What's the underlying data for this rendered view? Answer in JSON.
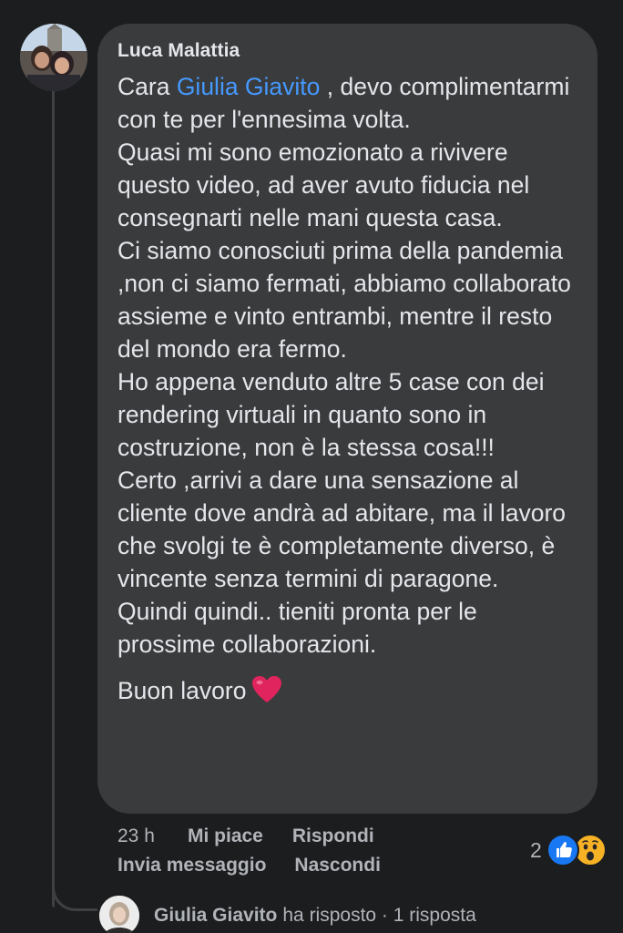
{
  "comment": {
    "author": "Luca Malattia",
    "mention": "Giulia Giavito",
    "line_intro_before": "Cara ",
    "line_intro_after": "  , devo complimentarmi con te per l'ennesima volta.",
    "paragraphs": [
      "Quasi mi sono emozionato a rivivere questo video, ad aver avuto fiducia nel consegnarti nelle mani questa casa.",
      "Ci siamo conosciuti prima della pandemia ,non ci siamo fermati, abbiamo collaborato assieme e vinto entrambi, mentre il resto del mondo era fermo.",
      "Ho appena venduto altre 5 case con dei rendering virtuali in quanto sono in costruzione,  non è la stessa cosa!!!",
      "Certo ,arrivi a dare una sensazione al cliente dove andrà ad abitare, ma il lavoro che svolgi te è completamente diverso, è vincente senza termini di paragone.",
      "Quindi quindi.. tieniti pronta per le prossime collaborazioni."
    ],
    "signoff": "Buon lavoro",
    "signoff_icon": "red-heart-icon"
  },
  "actions": {
    "time": "23 h",
    "like": "Mi piace",
    "reply": "Rispondi",
    "message": "Invia messaggio",
    "hide": "Nascondi"
  },
  "reactions": {
    "count": "2",
    "icons": [
      "like-icon",
      "wow-icon"
    ]
  },
  "reply_summary": {
    "name": "Giulia Giavito",
    "text": "ha risposto · 1 risposta"
  },
  "colors": {
    "background": "#1c1d1f",
    "bubble": "#3a3b3c",
    "mention": "#4599ff",
    "secondary_text": "#b0b3b8",
    "like": "#1877f2",
    "wow": "#f7b125",
    "heart": "#e0245e"
  }
}
